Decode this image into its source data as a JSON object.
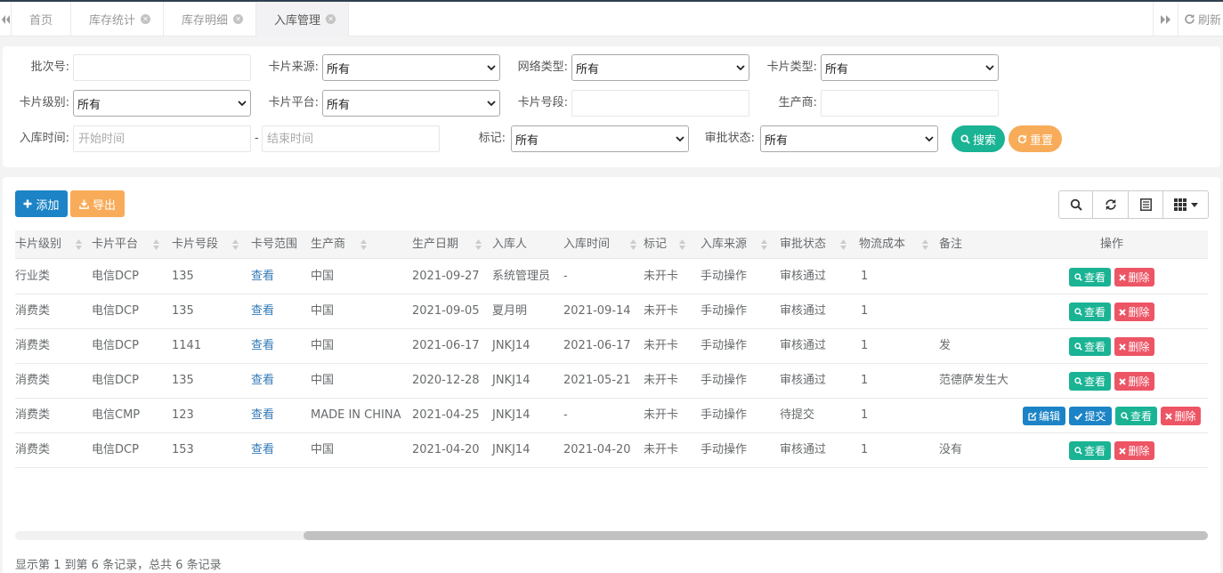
{
  "tabs": {
    "items": [
      {
        "label": "首页",
        "closable": false
      },
      {
        "label": "库存统计",
        "closable": true
      },
      {
        "label": "库存明细",
        "closable": true
      },
      {
        "label": "入库管理",
        "closable": true,
        "active": true
      }
    ],
    "refresh_label": "刷新"
  },
  "filters": {
    "batch_no": {
      "label": "批次号:",
      "value": "",
      "placeholder": ""
    },
    "card_source": {
      "label": "卡片来源:",
      "value": "所有"
    },
    "network_type": {
      "label": "网络类型:",
      "value": "所有"
    },
    "card_type": {
      "label": "卡片类型:",
      "value": "所有"
    },
    "card_level": {
      "label": "卡片级别:",
      "value": "所有"
    },
    "card_platform": {
      "label": "卡片平台:",
      "value": "所有"
    },
    "card_segment": {
      "label": "卡片号段:",
      "value": ""
    },
    "manufacturer": {
      "label": "生产商:",
      "value": ""
    },
    "stock_in_time": {
      "label": "入库时间:",
      "start_placeholder": "开始时间",
      "separator": "-",
      "end_placeholder": "结束时间"
    },
    "mark": {
      "label": "标记:",
      "value": "所有"
    },
    "approval_status": {
      "label": "审批状态:",
      "value": "所有"
    },
    "search_label": "搜索",
    "reset_label": "重置"
  },
  "toolbar": {
    "add_label": "添加",
    "export_label": "导出"
  },
  "table": {
    "columns": [
      "卡片级别",
      "卡片平台",
      "卡片号段",
      "卡号范围",
      "生产商",
      "生产日期",
      "入库人",
      "入库时间",
      "标记",
      "入库来源",
      "审批状态",
      "物流成本",
      "备注",
      "操作"
    ],
    "actions": {
      "view": "查看",
      "delete": "删除",
      "edit": "编辑",
      "submit": "提交"
    },
    "rows": [
      {
        "level": "行业类",
        "platform": "电信DCP",
        "segment": "135",
        "range": "查看",
        "maker": "中国",
        "prod_date": "2021-09-27",
        "operator": "系统管理员",
        "in_time": "-",
        "mark": "未开卡",
        "source": "手动操作",
        "status": "审核通过",
        "cost": "1",
        "remark": "",
        "editable": false
      },
      {
        "level": "消费类",
        "platform": "电信DCP",
        "segment": "135",
        "range": "查看",
        "maker": "中国",
        "prod_date": "2021-09-05",
        "operator": "夏月明",
        "in_time": "2021-09-14",
        "mark": "未开卡",
        "source": "手动操作",
        "status": "审核通过",
        "cost": "1",
        "remark": "",
        "editable": false
      },
      {
        "level": "消费类",
        "platform": "电信DCP",
        "segment": "1141",
        "range": "查看",
        "maker": "中国",
        "prod_date": "2021-06-17",
        "operator": "JNKJ14",
        "in_time": "2021-06-17",
        "mark": "未开卡",
        "source": "手动操作",
        "status": "审核通过",
        "cost": "1",
        "remark": "发",
        "editable": false
      },
      {
        "level": "消费类",
        "platform": "电信DCP",
        "segment": "135",
        "range": "查看",
        "maker": "中国",
        "prod_date": "2020-12-28",
        "operator": "JNKJ14",
        "in_time": "2021-05-21",
        "mark": "未开卡",
        "source": "手动操作",
        "status": "审核通过",
        "cost": "1",
        "remark": "范德萨发生大",
        "editable": false
      },
      {
        "level": "消费类",
        "platform": "电信CMP",
        "segment": "123",
        "range": "查看",
        "maker": "MADE IN CHINA",
        "prod_date": "2021-04-25",
        "operator": "JNKJ14",
        "in_time": "-",
        "mark": "未开卡",
        "source": "手动操作",
        "status": "待提交",
        "cost": "1",
        "remark": "",
        "editable": true
      },
      {
        "level": "消费类",
        "platform": "电信DCP",
        "segment": "153",
        "range": "查看",
        "maker": "中国",
        "prod_date": "2021-04-20",
        "operator": "JNKJ14",
        "in_time": "2021-04-20",
        "mark": "未开卡",
        "source": "手动操作",
        "status": "审核通过",
        "cost": "1",
        "remark": "没有",
        "editable": false
      }
    ]
  },
  "pagination": {
    "info": "显示第 1 到第 6 条记录，总共 6 条记录"
  },
  "colors": {
    "primary": "#1c84c6",
    "success": "#1ab394",
    "warning": "#f8ac59",
    "danger": "#ed5565",
    "link": "#337ab7"
  }
}
